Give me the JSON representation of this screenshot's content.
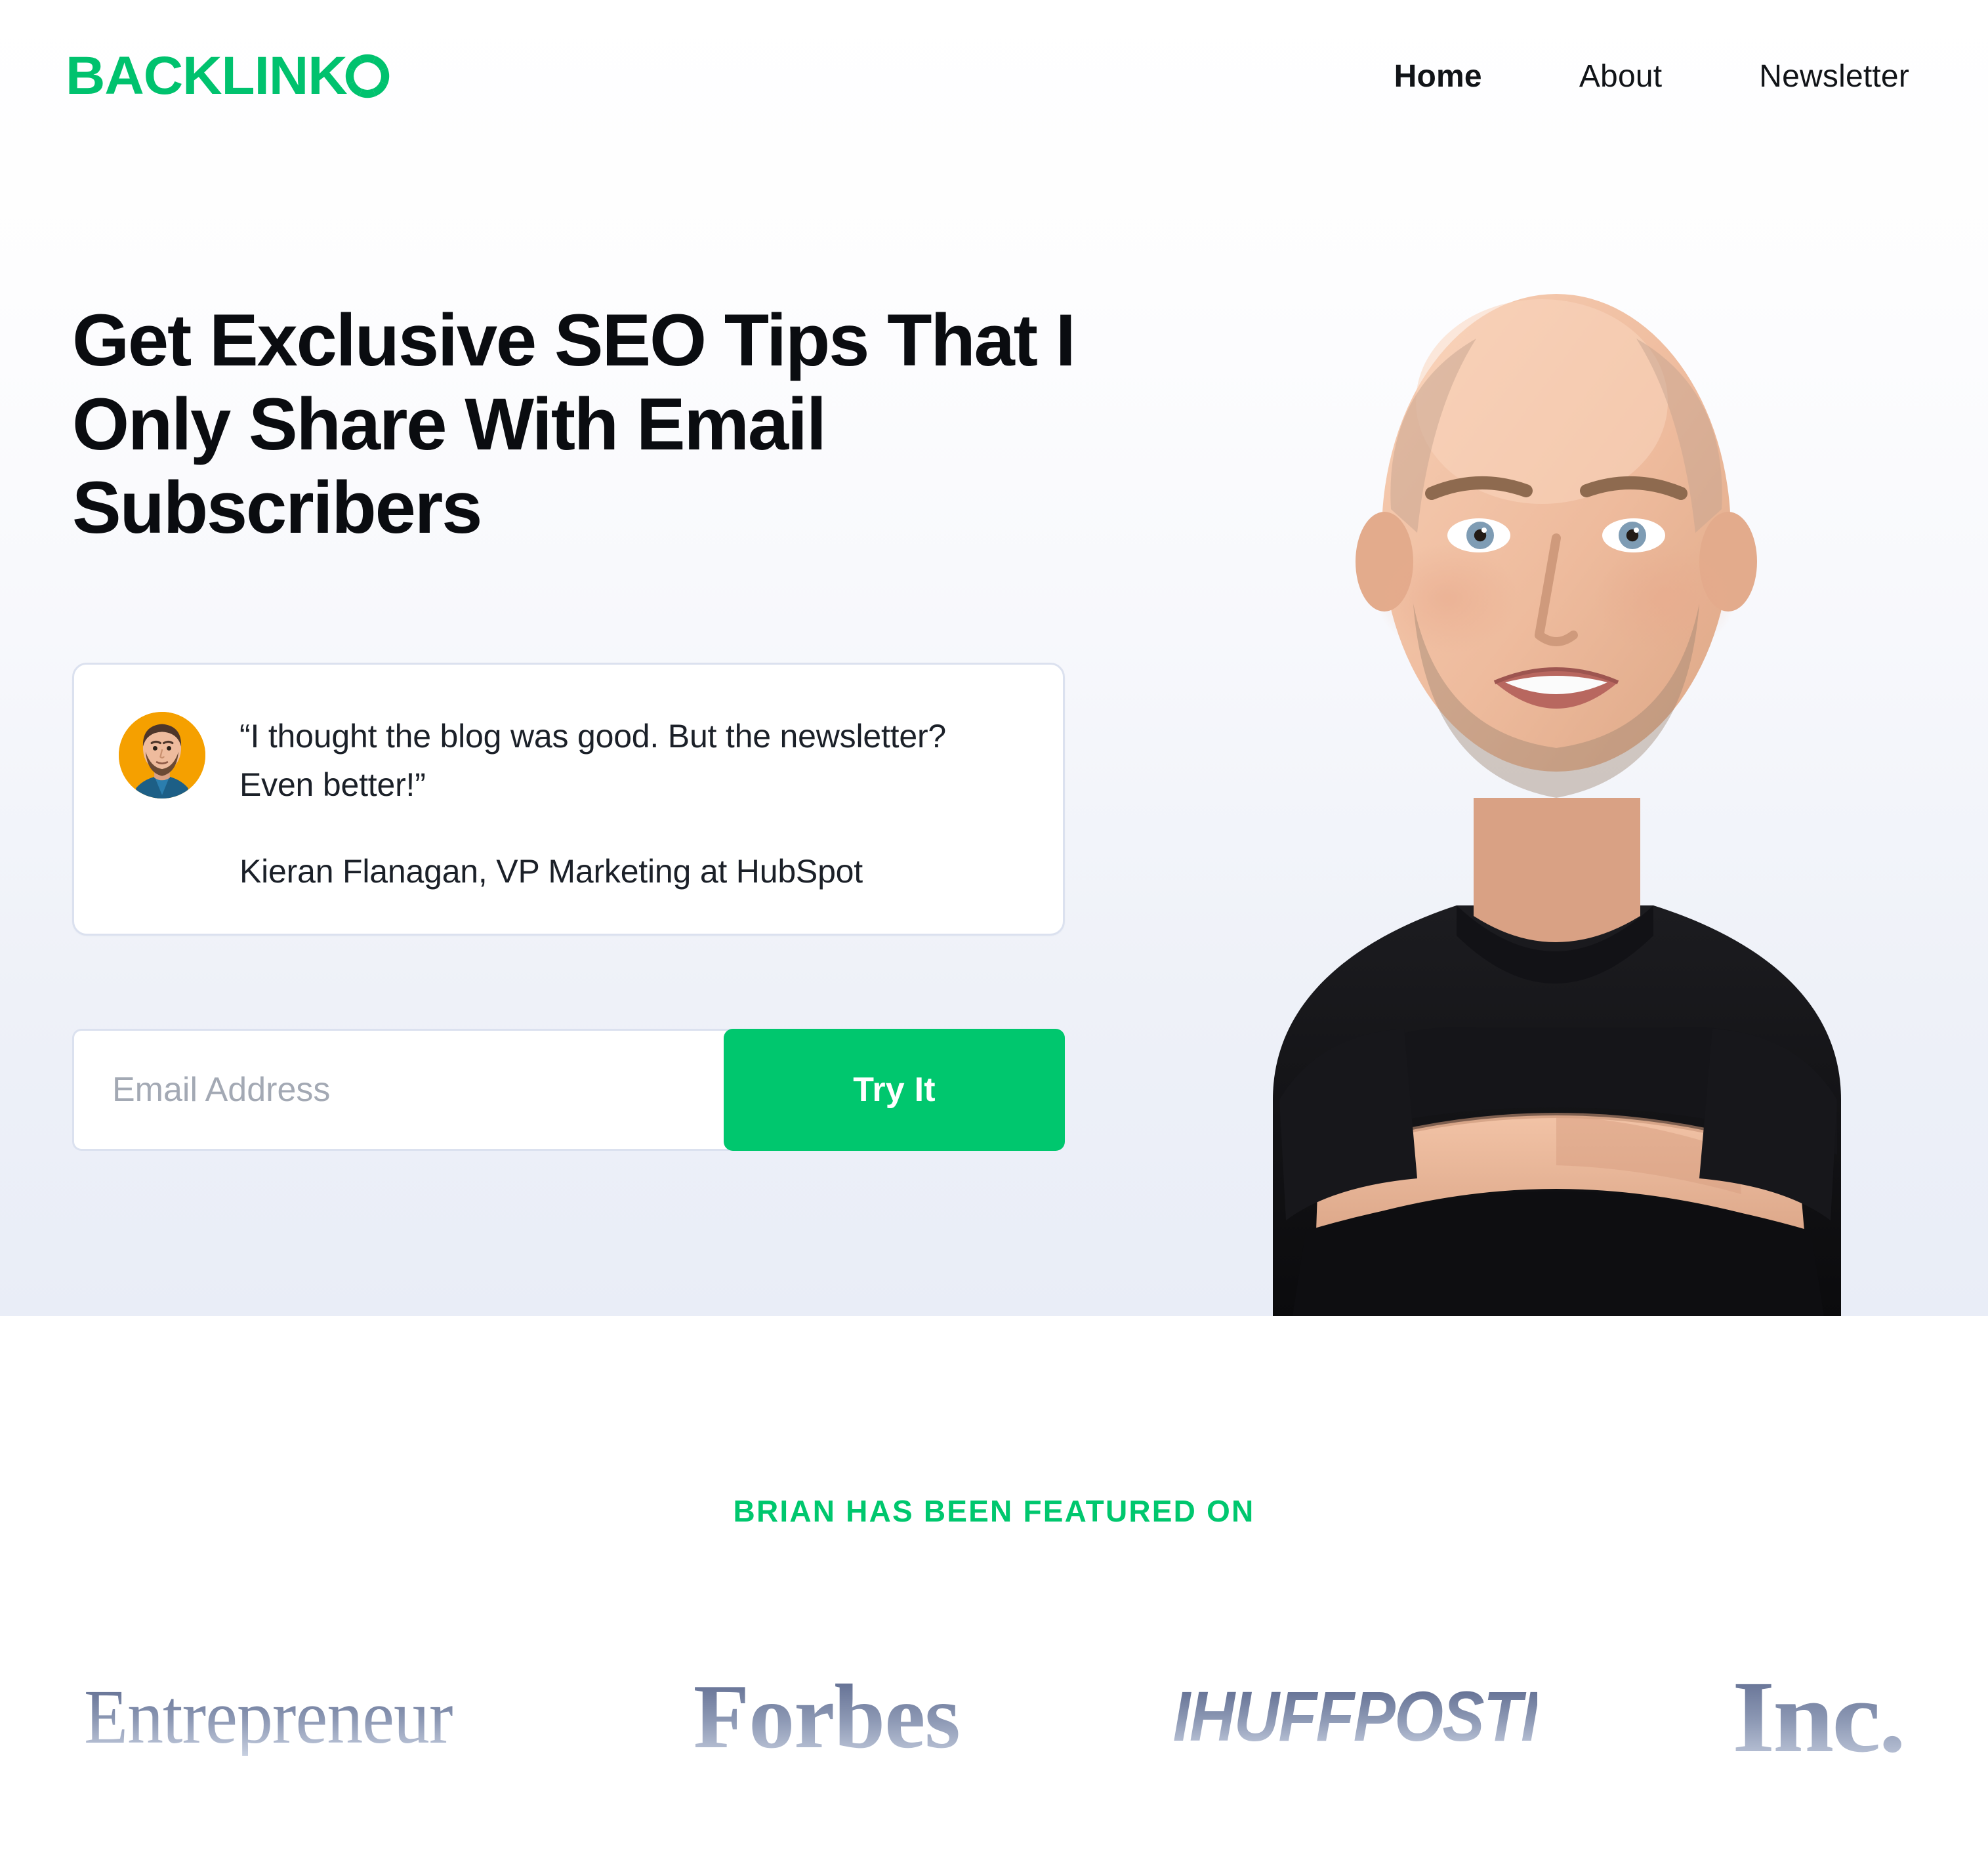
{
  "brand": {
    "logo_text": "BACKLINK",
    "logo_mark": "segmented-ring-o",
    "accent_color": "#00C76E"
  },
  "nav": {
    "items": [
      {
        "label": "Home",
        "active": true
      },
      {
        "label": "About",
        "active": false
      },
      {
        "label": "Newsletter",
        "active": false
      }
    ]
  },
  "hero": {
    "headline": "Get Exclusive SEO Tips That I Only Share With Email Subscribers",
    "headline_lines": [
      "Get Exclusive SEO Tips",
      "That I Only Share With",
      "Email Subscribers"
    ],
    "testimonial": {
      "quote": "“I thought the blog was good. But the newsletter? Even better!”",
      "attribution": "Kieran Flanagan, VP Marketing at HubSpot",
      "avatar_alt": "bearded-man-avatar",
      "avatar_background_color": "#F5A000"
    },
    "signup": {
      "email_placeholder": "Email Address",
      "email_value": "",
      "submit_label": "Try It",
      "submit_color": "#00C76E"
    },
    "photo_alt": "bald-smiling-man-arms-crossed-black-tshirt",
    "background_top": "#ffffff",
    "background_bottom": "#e9edf7"
  },
  "featured": {
    "kicker": "BRIAN HAS BEEN FEATURED ON",
    "kicker_color": "#00C76E",
    "logos": [
      {
        "name": "Entrepreneur",
        "label": "Entrepreneur"
      },
      {
        "name": "Forbes",
        "label": "Forbes"
      },
      {
        "name": "HuffPost",
        "label": "IHUFFPOSTI"
      },
      {
        "name": "Inc",
        "label": "Inc."
      }
    ]
  }
}
